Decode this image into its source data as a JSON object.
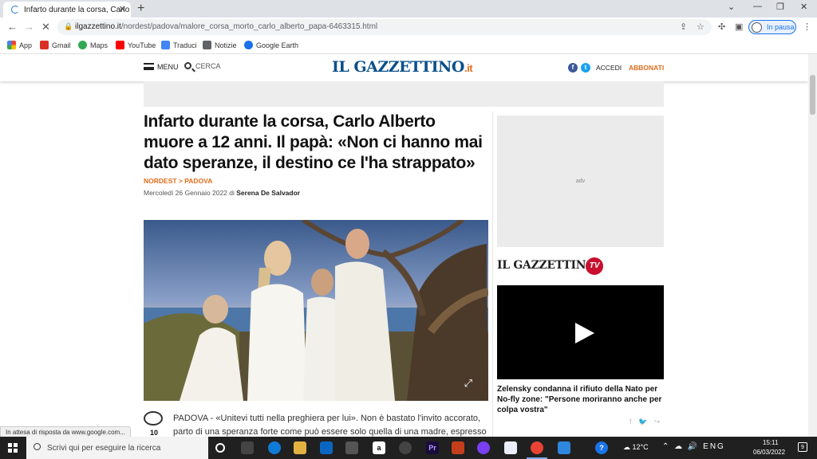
{
  "browser": {
    "tab_title": "Infarto durante la corsa, Carlo Alb",
    "tab_close": "✕",
    "new_tab": "+",
    "window_controls": [
      "⌄",
      "—",
      "❐",
      "✕"
    ],
    "url_host": "ilgazzettino.it",
    "url_path": "/nordest/padova/malore_corsa_morto_carlo_alberto_papa-6463315.html",
    "profile_status": "In pausa",
    "bookmarks": [
      {
        "label": "App",
        "icon": "apps-grid-icon",
        "color": "#ea4335"
      },
      {
        "label": "Gmail",
        "icon": "gmail-icon",
        "color": "#d93025"
      },
      {
        "label": "Maps",
        "icon": "maps-icon",
        "color": "#34a853"
      },
      {
        "label": "YouTube",
        "icon": "youtube-icon",
        "color": "#ff0000"
      },
      {
        "label": "Traduci",
        "icon": "translate-icon",
        "color": "#4285f4"
      },
      {
        "label": "Notizie",
        "icon": "news-icon",
        "color": "#5f6368"
      },
      {
        "label": "Google Earth",
        "icon": "earth-icon",
        "color": "#1a73e8"
      }
    ]
  },
  "site": {
    "menu_label": "MENU",
    "search_label": "CERCA",
    "logo_main": "IL GAZZETTINO",
    "logo_suffix": ".it",
    "login_label": "ACCEDI",
    "subscribe_label": "ABBONATI",
    "brand_blue": "#0b4f8a",
    "brand_orange": "#e06d1c"
  },
  "article": {
    "headline": "Infarto durante la corsa, Carlo Alberto muore a 12 anni. Il papà: «Non ci hanno mai dato speranze, il destino ce l'ha strappato»",
    "breadcrumb_section": "NORDEST",
    "breadcrumb_sep": " > ",
    "breadcrumb_city": "PADOVA",
    "date": "Mercoledì 26 Gennaio 2022",
    "by": " di ",
    "author": "Serena De Salvador",
    "comments_count": "10",
    "body_lead": "PADOVA - ",
    "body_text": "«Unitevi tutti nella preghiera per lui». Non è bastato l'invito accorato, parto di una speranza forte come può essere solo quella di una madre, espresso"
  },
  "sidebar": {
    "adv_label": "adv",
    "tv_logo": "IL GAZZETTINO",
    "tv_badge": "TV",
    "video_caption": "Zelensky condanna il rifiuto della Nato per No-fly zone: \"Persone moriranno anche per colpa vostra\"",
    "share_icons": "f 🐦 ↪"
  },
  "status_bar": "In attesa di risposta da www.google.com...",
  "taskbar": {
    "search_placeholder": "Scrivi qui per eseguire la ricerca",
    "temperature": "12°C",
    "time": "15:11",
    "date": "06/03/2022",
    "notifications": "9",
    "tray_icons": "⌃ ☁ 🔊 ENG"
  }
}
